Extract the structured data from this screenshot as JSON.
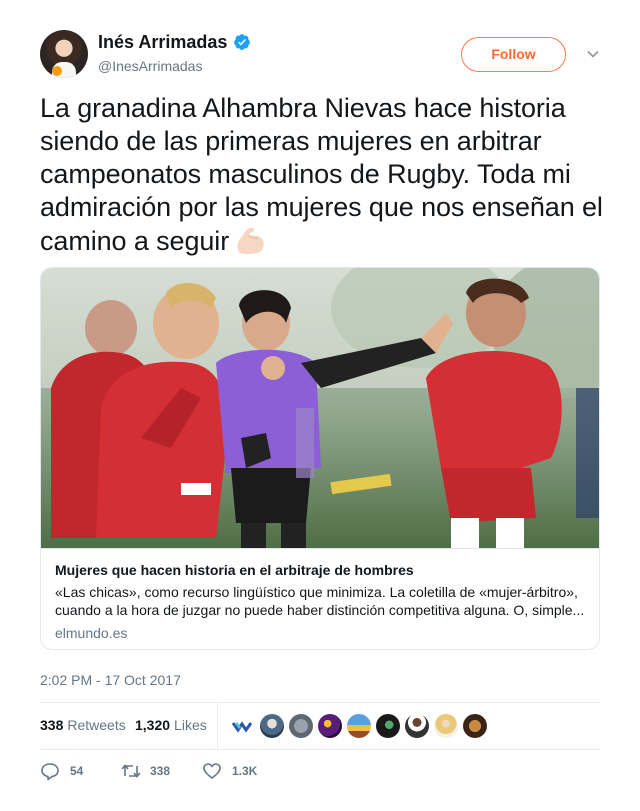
{
  "author": {
    "name": "Inés Arrimadas",
    "handle": "@InesArrimadas",
    "verified": true
  },
  "follow_button": {
    "label": "Follow"
  },
  "tweet": {
    "text": "La granadina Alhambra Nievas hace historia siendo de las primeras mujeres en arbitrar campeonatos masculinos de Rugby. Toda mi admiración por las mujeres que nos enseñan el camino a seguir",
    "emoji": "flexed-biceps-icon"
  },
  "card": {
    "title": "Mujeres que hacen historia en el arbitraje de hombres",
    "desc_line1": "«Las chicas», como recurso lingüístico que minimiza. La coletilla de «mujer-árbitro»,",
    "desc_line2": "cuando a la hora de juzgar no puede haber distinción competitiva alguna. O, simple...",
    "domain": "elmundo.es"
  },
  "timestamp": "2:02 PM - 17 Oct 2017",
  "stats": {
    "retweets_count": "338",
    "retweets_label": "Retweets",
    "likes_count": "1,320",
    "likes_label": "Likes"
  },
  "actions": {
    "replies": "54",
    "retweets": "338",
    "likes": "1.3K"
  },
  "colors": {
    "accent": "#ff6a2f",
    "verified": "#1da1f2",
    "muted": "#657786"
  }
}
